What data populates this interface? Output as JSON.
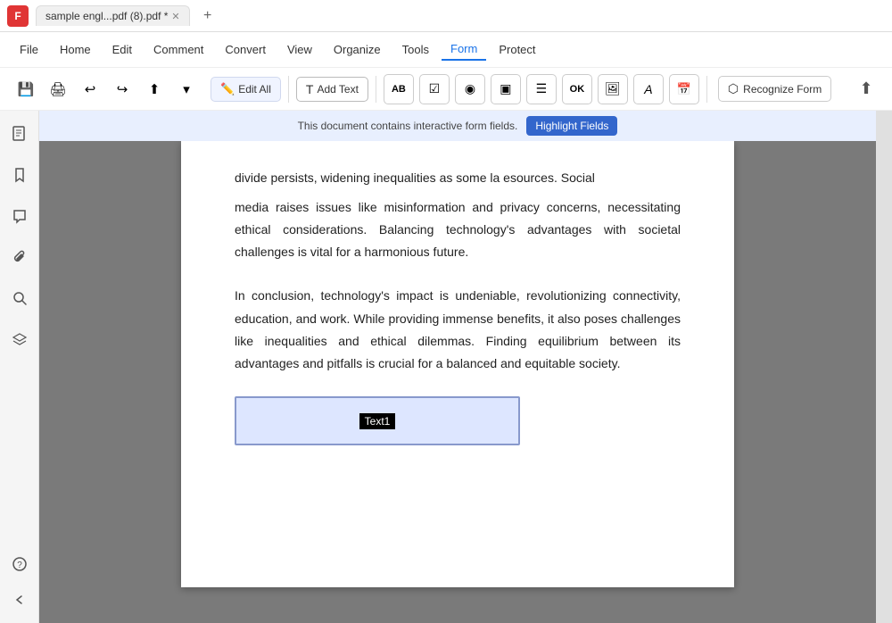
{
  "app": {
    "logo": "F",
    "title": "sample  engl...pdf (8).pdf *"
  },
  "tabs": [
    {
      "label": "sample  engl...pdf (8).pdf *",
      "active": true
    }
  ],
  "menu": {
    "file": "File",
    "items": [
      "Home",
      "Edit",
      "Comment",
      "Convert",
      "View",
      "Organize",
      "Tools",
      "Form",
      "Protect"
    ]
  },
  "toolbar": {
    "edit_all": "Edit All",
    "add_text": "Add Text",
    "recognize_form": "Recognize Form",
    "icons": [
      "AB",
      "✓",
      "◉",
      "⬛",
      "☰",
      "OK",
      "🖼",
      "A",
      "📅"
    ]
  },
  "notification": {
    "message": "This document contains interactive form fields.",
    "button": "Highlight Fields"
  },
  "sidebar": {
    "icons": [
      "📄",
      "🔖",
      "💬",
      "📎",
      "🔍",
      "⬡",
      "❓",
      "<"
    ]
  },
  "document": {
    "top_text": "divide persists, widening inequalities as some la                                 esources. Social",
    "paragraph1": "media raises issues like misinformation and privacy concerns, necessitating ethical considerations. Balancing technology's advantages with societal challenges is vital for a harmonious future.",
    "paragraph2": "In conclusion, technology's impact is undeniable, revolutionizing connectivity, education, and work. While providing immense benefits, it also poses challenges like inequalities and ethical dilemmas. Finding equilibrium between its advantages and pitfalls is crucial for a balanced and equitable society.",
    "text_field_label": "Text1"
  },
  "colors": {
    "accent": "#1a73e8",
    "form_active": "#3366cc",
    "toolbar_bg": "#f0f4ff",
    "notify_bg": "#e8effe",
    "field_bg": "#dde6ff",
    "field_border": "#8899cc"
  }
}
